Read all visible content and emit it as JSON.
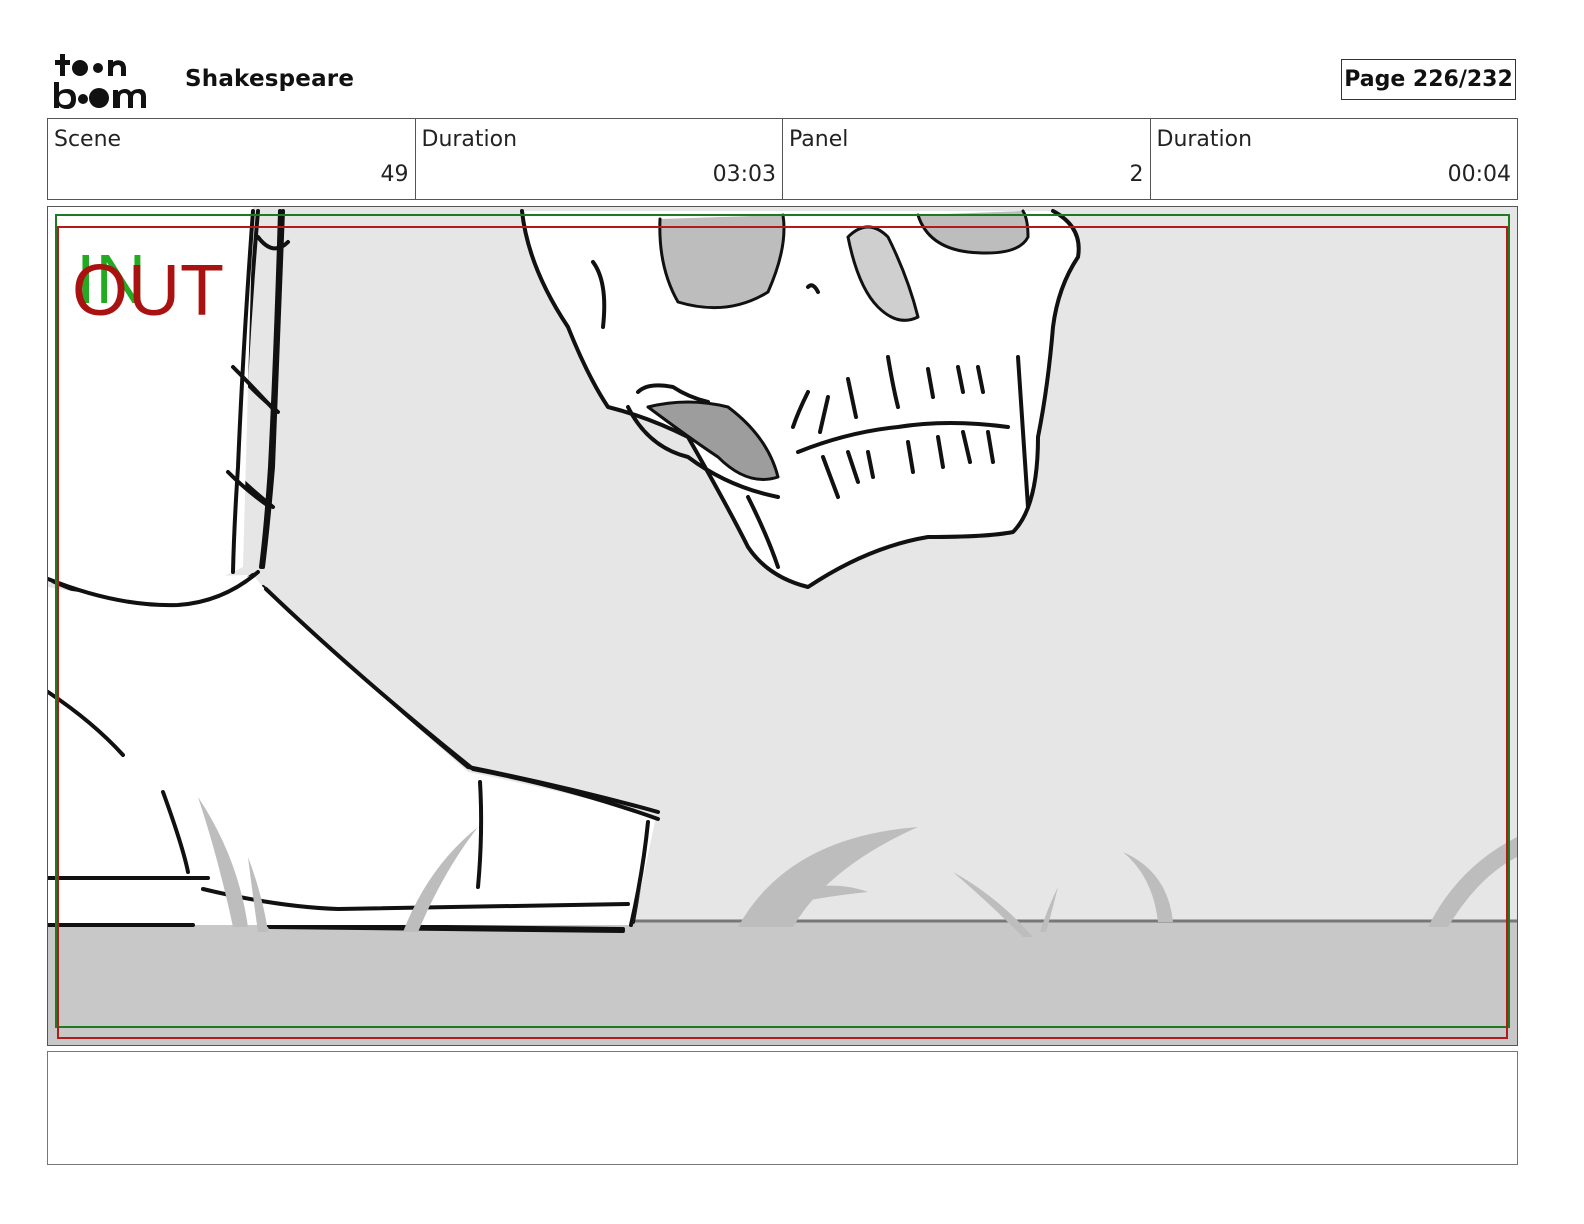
{
  "header": {
    "logo_text": "toon boom",
    "project_title": "Shakespeare",
    "page_label": "Page 226/232"
  },
  "info": [
    {
      "label": "Scene",
      "value": "49"
    },
    {
      "label": "Duration",
      "value": "03:03"
    },
    {
      "label": "Panel",
      "value": "2"
    },
    {
      "label": "Duration",
      "value": "00:04"
    }
  ],
  "panel": {
    "in_marker": "IN",
    "out_marker": "OUT",
    "colors": {
      "in_color": "#22aa22",
      "out_color": "#aa1111",
      "sky": "#e6e6e6",
      "ground": "#c8c8c8",
      "grass": "#bdbdbd"
    }
  },
  "notes": {
    "text": ""
  }
}
